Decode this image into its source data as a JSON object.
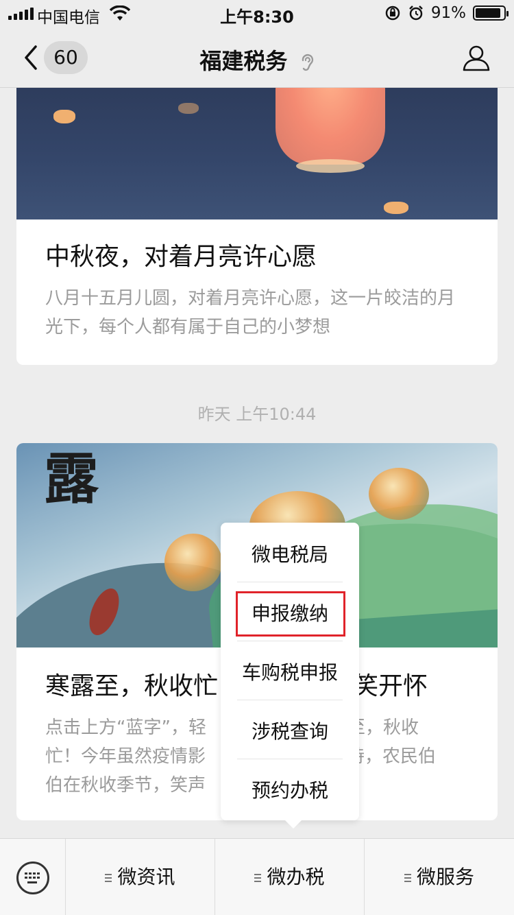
{
  "status_bar": {
    "carrier": "中国电信",
    "time": "上午8:30",
    "battery": "91%",
    "battery_level": 0.91
  },
  "nav": {
    "badge": "60",
    "title": "福建税务"
  },
  "articles": [
    {
      "title": "中秋夜，对着月亮许心愿",
      "desc": "八月十五月儿圆，对着月亮许心愿，这一片皎洁的月光下，每个人都有属于自己的小梦想"
    },
    {
      "title": "寒露至，秋收忙",
      "title_tail": "笑开怀",
      "desc_l1": "点击上方“蓝字”，轻",
      "desc_l1_tail": "至，秋收",
      "desc_l2": "忙！今年虽然疫情影",
      "desc_l2_tail": "持，农民伯",
      "desc_l3": "伯在秋收季节，笑声"
    }
  ],
  "timestamp": "昨天 上午10:44",
  "popup_menu": {
    "items": [
      "微电税局",
      "申报缴纳",
      "车购税申报",
      "涉税查询",
      "预约办税"
    ],
    "highlighted": "申报缴纳",
    "highlight_color": "#e0232a"
  },
  "bottom_menu": {
    "items": [
      "微资讯",
      "微办税",
      "微服务"
    ]
  },
  "icons": [
    "signal-icon",
    "wifi-icon",
    "lock-rotation-icon",
    "alarm-icon",
    "battery-icon",
    "back-chevron-icon",
    "ear-icon",
    "person-icon",
    "keyboard-icon",
    "menu-lines-icon"
  ]
}
